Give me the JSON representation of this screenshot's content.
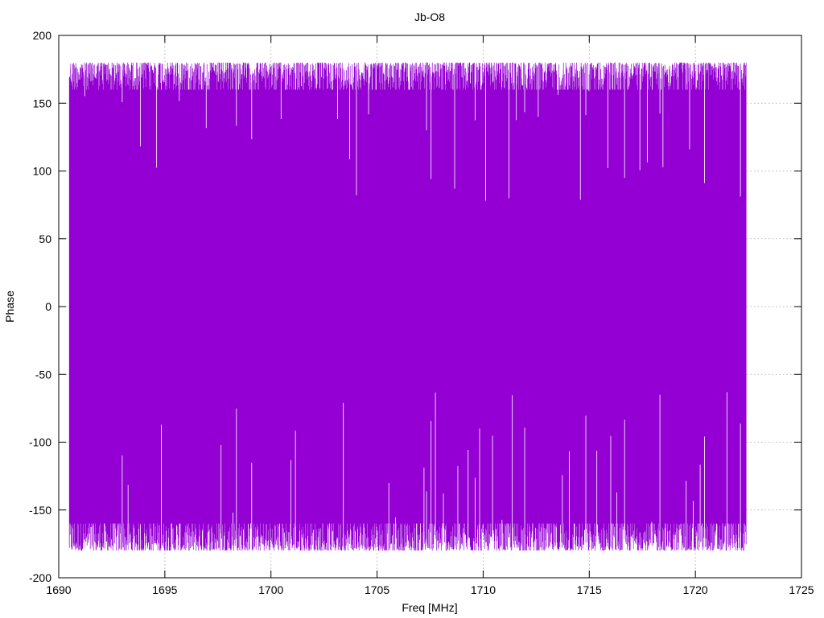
{
  "chart_data": {
    "type": "line",
    "title": "Jb-O8",
    "xlabel": "Freq [MHz]",
    "ylabel": "Phase",
    "xlim": [
      1690,
      1725
    ],
    "ylim": [
      -200,
      200
    ],
    "xticks": [
      "1690",
      "1695",
      "1700",
      "1705",
      "1710",
      "1715",
      "1720",
      "1725"
    ],
    "yticks": [
      "200",
      "150",
      "100",
      "50",
      "0",
      "-50",
      "-100",
      "-150",
      "-200"
    ],
    "grid": true,
    "series": [
      {
        "color": "#9400d3",
        "x_start": 1690.5,
        "x_end": 1722.4,
        "y_min": -180,
        "y_max": 180,
        "description": "dense phase-vs-frequency trace wrapping between -180 and 180 degrees"
      }
    ]
  }
}
